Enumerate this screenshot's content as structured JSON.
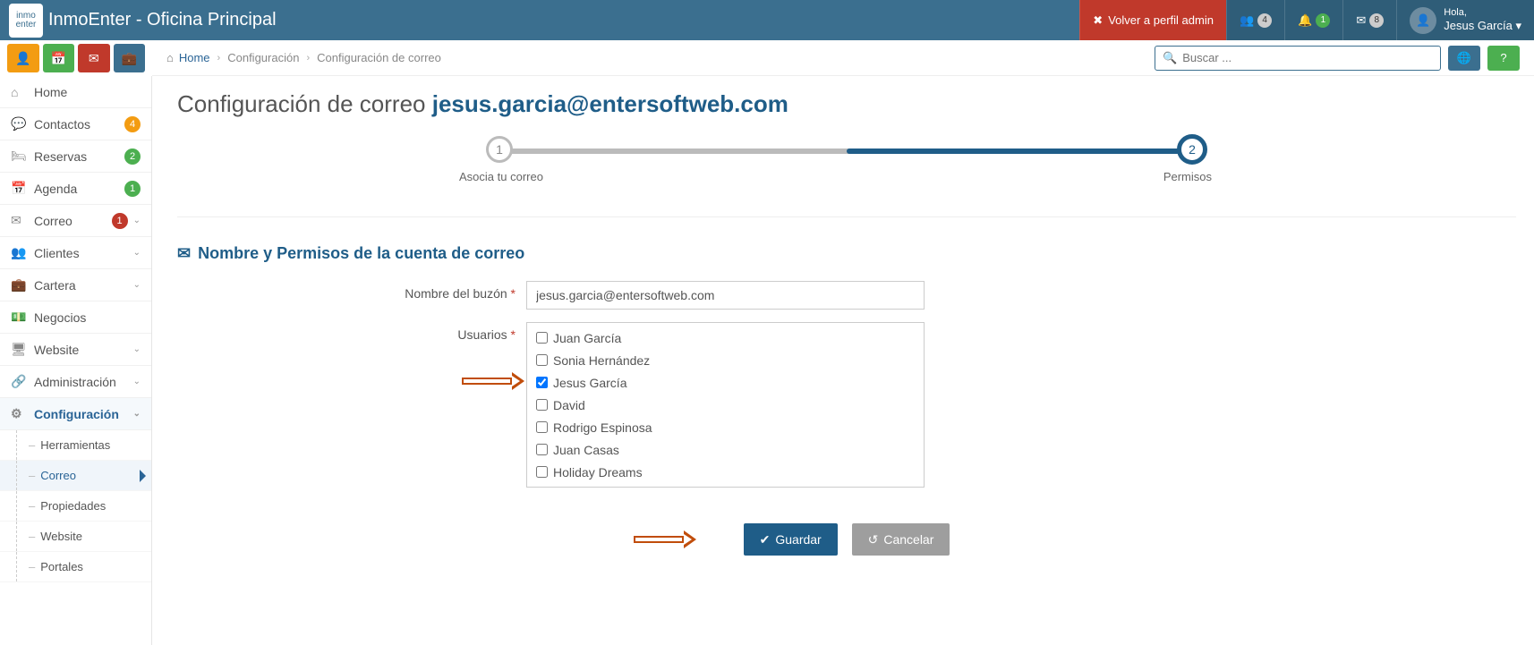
{
  "top": {
    "app_title": "InmoEnter - Oficina Principal",
    "back_admin": "Volver a perfil admin",
    "users_badge": "4",
    "bell_badge": "1",
    "mail_badge": "8",
    "greeting": "Hola,",
    "username": "Jesus García"
  },
  "search": {
    "placeholder": "Buscar ..."
  },
  "crumbs": {
    "home": "Home",
    "c1": "Configuración",
    "c2": "Configuración de correo"
  },
  "sidebar": {
    "items": [
      {
        "icon": "⌂",
        "label": "Home"
      },
      {
        "icon": "💬",
        "label": "Contactos",
        "badge": "4",
        "bcolor": "#f39c12"
      },
      {
        "icon": "🛏",
        "label": "Reservas",
        "badge": "2",
        "bcolor": "#4caf50"
      },
      {
        "icon": "📅",
        "label": "Agenda",
        "badge": "1",
        "bcolor": "#4caf50"
      },
      {
        "icon": "✉",
        "label": "Correo",
        "badge": "1",
        "bcolor": "#c0392b",
        "caret": true
      },
      {
        "icon": "👥",
        "label": "Clientes",
        "caret": true
      },
      {
        "icon": "💼",
        "label": "Cartera",
        "caret": true
      },
      {
        "icon": "💵",
        "label": "Negocios"
      },
      {
        "icon": "🖥",
        "label": "Website",
        "caret": true
      },
      {
        "icon": "🔗",
        "label": "Administración",
        "caret": true
      },
      {
        "icon": "⚙",
        "label": "Configuración",
        "caret": true,
        "active": true
      }
    ],
    "subitems": [
      "Herramientas",
      "Correo",
      "Propiedades",
      "Website",
      "Portales"
    ],
    "active_sub": 1
  },
  "page": {
    "title_prefix": "Configuración de correo ",
    "title_email": "jesus.garcia@entersoftweb.com",
    "step1_label": "Asocia tu correo",
    "step2_label": "Permisos",
    "section_title": "Nombre y Permisos de la cuenta de correo",
    "mailbox_label": "Nombre del buzón",
    "mailbox_value": "jesus.garcia@entersoftweb.com",
    "users_label": "Usuarios",
    "users": [
      {
        "name": "Juan García",
        "checked": false
      },
      {
        "name": "Sonia Hernández",
        "checked": false
      },
      {
        "name": "Jesus García",
        "checked": true
      },
      {
        "name": "David",
        "checked": false
      },
      {
        "name": "Rodrigo Espinosa",
        "checked": false
      },
      {
        "name": "Juan Casas",
        "checked": false
      },
      {
        "name": "Holiday Dreams",
        "checked": false
      }
    ],
    "save_label": "Guardar",
    "cancel_label": "Cancelar"
  }
}
